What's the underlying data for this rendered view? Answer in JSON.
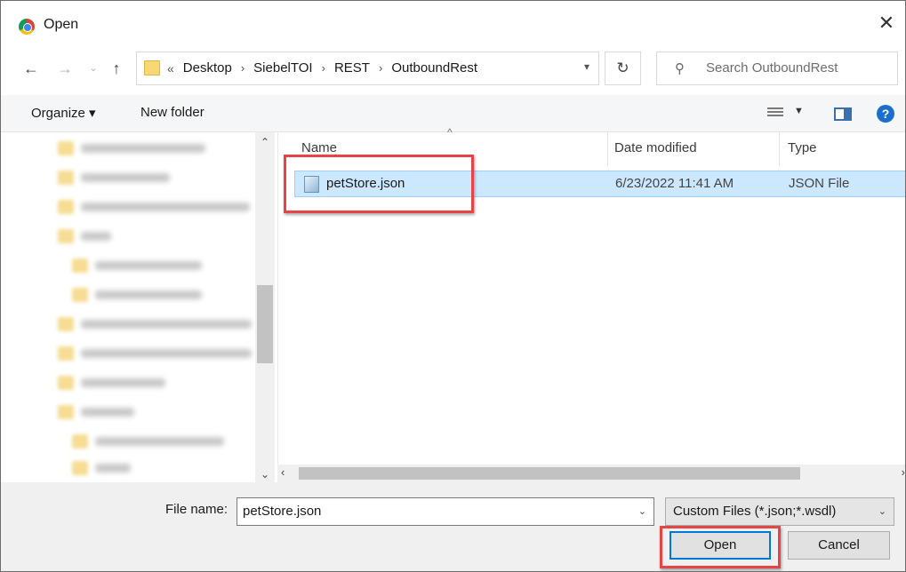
{
  "window": {
    "title": "Open"
  },
  "address": {
    "overflow": "«",
    "crumbs": [
      "Desktop",
      "SiebelTOI",
      "REST",
      "OutboundRest"
    ]
  },
  "search": {
    "placeholder": "Search OutboundRest"
  },
  "toolbar": {
    "organize": "Organize ▾",
    "new_folder": "New folder"
  },
  "columns": {
    "name": "Name",
    "date": "Date modified",
    "type": "Type"
  },
  "files": [
    {
      "name": "petStore.json",
      "date": "6/23/2022 11:41 AM",
      "type": "JSON File",
      "selected": true
    }
  ],
  "bottom": {
    "file_name_label": "File name:",
    "file_name_value": "petStore.json",
    "filter": "Custom Files (*.json;*.wsdl)",
    "open_label": "Open",
    "cancel_label": "Cancel"
  },
  "icons": {
    "app": "chrome-icon",
    "close": "close-icon",
    "back": "back-arrow-icon",
    "forward": "forward-arrow-icon",
    "recent": "chevron-down-icon",
    "up": "up-arrow-icon",
    "folder": "folder-icon",
    "refresh": "refresh-icon",
    "search": "search-icon",
    "view": "view-options-icon",
    "preview": "preview-pane-icon",
    "help": "help-icon",
    "json": "json-file-icon"
  },
  "colors": {
    "selection": "#cce8ff",
    "accent": "#0078d7",
    "highlight": "#e64545"
  }
}
